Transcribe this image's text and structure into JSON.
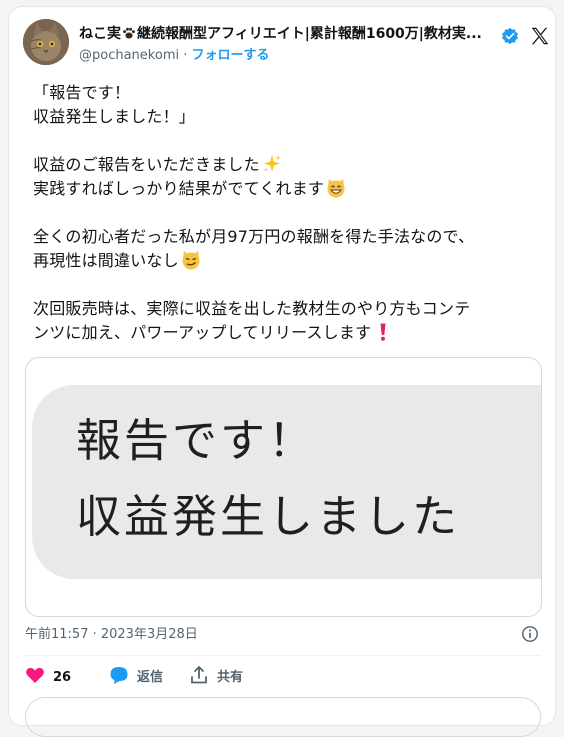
{
  "tweet": {
    "display_name": "ねこ実",
    "display_name_rest": "継続報酬型アフィリエイト|累計報酬1600万|教材実...",
    "handle": "@pochanekomi",
    "separator": " · ",
    "follow_label": "フォローする",
    "body": {
      "line1": "「報告です！",
      "line2": "収益発生しました！」",
      "line3": "収益のご報告をいただきました",
      "line4": "実践すればしっかり結果がでてくれます",
      "line5": "全くの初心者だった私が月97万円の報酬を得た手法なので、",
      "line6": "再現性は間違いなし",
      "line7": "次回販売時は、実際に収益を出した教材生のやり方もコンテ",
      "line8": "ンツに加え、パワーアップしてリリースします"
    },
    "media": {
      "line1": "報告です！",
      "line2": "収益発生しました"
    },
    "timestamp": "午前11:57 · 2023年3月28日",
    "actions": {
      "like_count": "26",
      "reply_label": "返信",
      "share_label": "共有"
    },
    "colors": {
      "accent": "#1d9bf0",
      "like": "#f91880",
      "text": "#0f1419",
      "muted": "#536471"
    },
    "icons": [
      "paw-icon",
      "verified-badge-icon",
      "x-logo-icon",
      "sparkles-icon",
      "grinning-cat-icon",
      "smirking-cat-icon",
      "exclamation-icon",
      "info-icon",
      "heart-icon",
      "reply-icon",
      "share-icon"
    ]
  }
}
